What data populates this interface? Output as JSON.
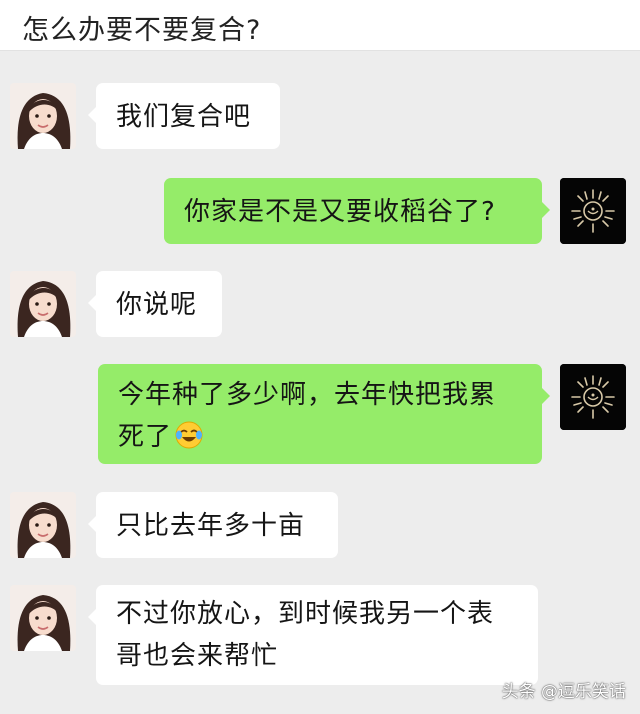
{
  "header": {
    "title": "怎么办要不要复合?"
  },
  "messages": [
    {
      "side": "in",
      "text": "我们复合吧"
    },
    {
      "side": "out",
      "text": "你家是不是又要收稻谷了?"
    },
    {
      "side": "in",
      "text": "你说呢"
    },
    {
      "side": "out",
      "text": "今年种了多少啊，去年快把我累死了",
      "emoji": "laughing-tears-emoji"
    },
    {
      "side": "in",
      "text": "只比去年多十亩"
    },
    {
      "side": "in",
      "text": "不过你放心，到时候我另一个表哥也会来帮忙"
    }
  ],
  "watermark": "头条 @逗乐笑话",
  "colors": {
    "outgoing_bubble": "#95ec69",
    "incoming_bubble": "#ffffff",
    "chat_background": "#ededed"
  }
}
